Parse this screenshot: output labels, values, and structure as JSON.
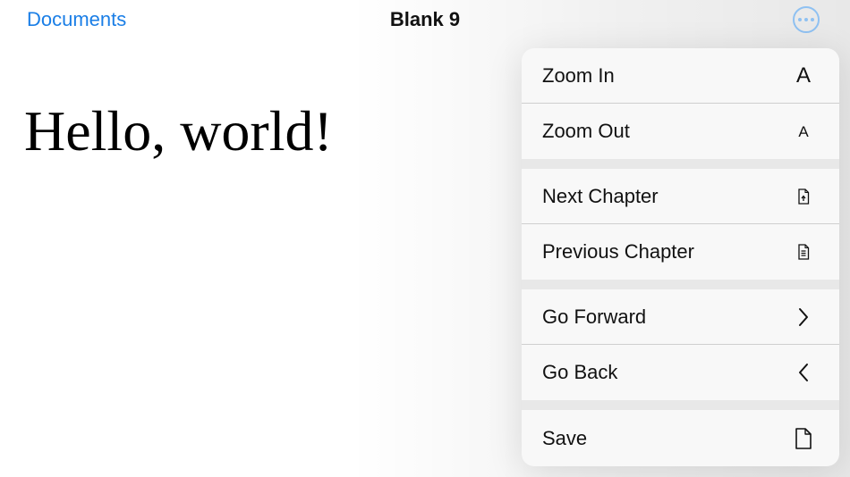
{
  "nav": {
    "back_label": "Documents",
    "title": "Blank 9",
    "more_icon": "ellipsis-circle-icon"
  },
  "document": {
    "text": "Hello, world!"
  },
  "menu": {
    "items": [
      {
        "label": "Zoom In",
        "icon": "A",
        "icon_name": "text-size-large-icon"
      },
      {
        "label": "Zoom Out",
        "icon": "A",
        "icon_name": "text-size-small-icon"
      },
      {
        "label": "Next Chapter",
        "icon_name": "document-next-icon"
      },
      {
        "label": "Previous Chapter",
        "icon_name": "document-previous-icon"
      },
      {
        "label": "Go Forward",
        "icon_name": "chevron-right-icon"
      },
      {
        "label": "Go Back",
        "icon_name": "chevron-left-icon"
      },
      {
        "label": "Save",
        "icon_name": "document-icon"
      }
    ]
  },
  "colors": {
    "accent": "#1a7ee6",
    "more_button": "#8fc1f2",
    "menu_background": "#f8f8f8",
    "menu_group_gap": "#e8e8e8"
  }
}
